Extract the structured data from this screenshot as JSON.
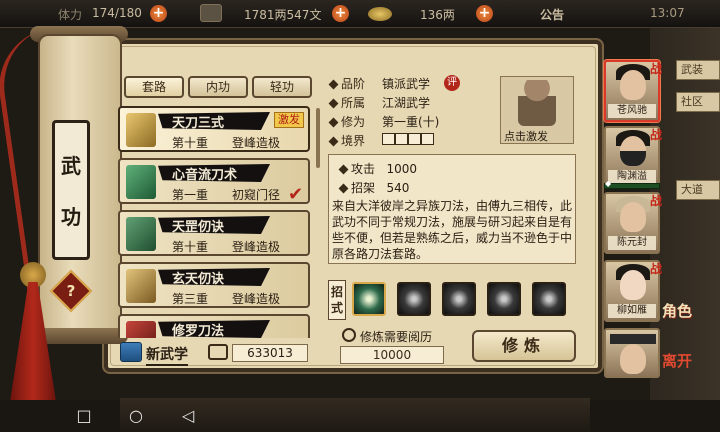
{
  "status_bar": {
    "stamina_label": "体力",
    "stamina": "174/180",
    "silver": "1781两547文",
    "gold": "136两",
    "announcement": "公告",
    "time": "13:07"
  },
  "right_labels": [
    "武装",
    "社区",
    "大道"
  ],
  "scroll": {
    "title_top": "武",
    "title_bottom": "功",
    "help": "?"
  },
  "tabs": [
    "套路",
    "内功",
    "轻功"
  ],
  "skills": [
    {
      "name": "天刀三式",
      "level": "第十重",
      "stage": "登峰造极",
      "badge": "激发",
      "selected": true
    },
    {
      "name": "心音流刀术",
      "level": "第一重",
      "stage": "初窥门径",
      "checked": true
    },
    {
      "name": "天罡仞诀",
      "level": "第十重",
      "stage": "登峰造极"
    },
    {
      "name": "玄天仞诀",
      "level": "第三重",
      "stage": "登峰造极"
    },
    {
      "name": "修罗刀法",
      "level": "",
      "stage": ""
    }
  ],
  "bottom_left": {
    "new_skill": "新武学",
    "exp": "633013"
  },
  "detail": {
    "grade_label": "品阶",
    "grade": "镇派武学",
    "grade_badge": "评",
    "category_label": "所属",
    "category": "江湖武学",
    "cultivation_label": "修为",
    "cultivation": "第一重(十)",
    "realm_label": "境界",
    "train_trigger": "点击激发",
    "attack_label": "攻击",
    "attack": "1000",
    "parry_label": "招架",
    "parry": "540",
    "description": "来自大洋彼岸之异族刀法，由傅九三相传，此武功不同于常规刀法，施展与研习起来自是有些不便，但若是熟练之后，威力当不逊色于中原各路刀法套路。",
    "moves_label": "招式",
    "requirement_label": "修炼需要阅历",
    "requirement": "10000",
    "train_button": "修炼"
  },
  "characters": [
    {
      "name": "苍风驰",
      "selected": true
    },
    {
      "name": "陶渊溢"
    },
    {
      "name": "陈元封"
    },
    {
      "name": "柳如雁"
    },
    {
      "name": ""
    }
  ],
  "side_buttons": {
    "role": "角色",
    "leave": "离开"
  },
  "colors": {
    "parchment": "#e7d8b4",
    "frame": "#3e3020",
    "accent_red": "#b3261a"
  }
}
